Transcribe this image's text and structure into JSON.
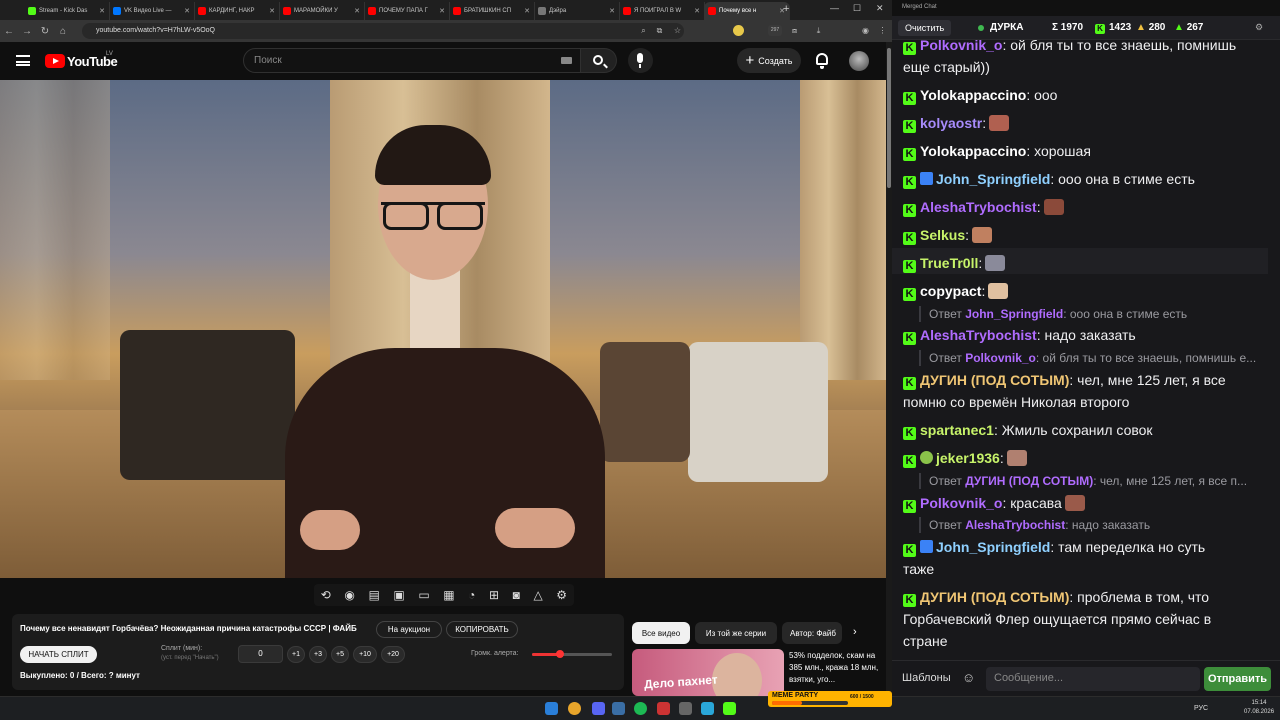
{
  "browser": {
    "tabs": [
      {
        "title": "Stream - Kick Das",
        "color": "#53fc18"
      },
      {
        "title": "VK Видео Live —",
        "color": "#0077ff"
      },
      {
        "title": "КАРДИНГ, НАКР",
        "color": "#ff0000"
      },
      {
        "title": "МАРАМОЙКИ У",
        "color": "#ff0000"
      },
      {
        "title": "ПОЧЕМУ ПАПА Г",
        "color": "#ff0000"
      },
      {
        "title": "БРАТИШКИН СП",
        "color": "#ff0000"
      },
      {
        "title": "Дэйра",
        "color": "#777777"
      },
      {
        "title": "Я ПОИГРАЛ В W",
        "color": "#ff0000"
      },
      {
        "title": "Почему все н",
        "color": "#ff0000"
      }
    ],
    "url": "youtube.com/watch?v=H7hLW-v5OoQ",
    "ext_badge": "297"
  },
  "youtube": {
    "wordmark": "YouTube",
    "region": "LV",
    "search_placeholder": "Поиск",
    "create_label": "Создать"
  },
  "panel": {
    "title": "Почему все ненавидят Горбачёва? Неожиданная причина катастрофы СССР | ФАЙБ",
    "auction_label": "На аукцион",
    "copy_label": "КОПИРОВАТЬ",
    "start_split_label": "НАЧАТЬ СПЛИТ",
    "split_min_label": "Сплит (мин):",
    "split_hint": "(уст. перед \"Начать\")",
    "split_value": "0",
    "increments": [
      "+1",
      "+3",
      "+5",
      "+10",
      "+20"
    ],
    "alert_label": "Громк. алерта:",
    "alert_volume": 0.35,
    "stats": "Выкуплено: 0 / Всего: ? минут"
  },
  "related": {
    "tabs": [
      "Все видео",
      "Из той же серии",
      "Автор: Файб"
    ],
    "thumb_text": "Дело пахнет",
    "title": "53% подделок, скам на 385 млн., кража 18 млн, взятки, уго..."
  },
  "chat": {
    "window_title": "Merged Chat",
    "clear_label": "Очистить",
    "channel": "ДУРКА",
    "stats": [
      "Σ 1970",
      "1423",
      "280",
      "267"
    ],
    "messages": [
      {
        "user": "Polkovnik_o",
        "color": "#b06cff",
        "text": ": ой бля ты то все знаешь, помнишь",
        "cont": "еще старый))"
      },
      {
        "user": "Yolokappaccino",
        "color": "#ffffff",
        "text": ": ооо"
      },
      {
        "user": "kolyaostr",
        "color": "#a78bfa",
        "text": ":"
      },
      {
        "user": "Yolokappaccino",
        "color": "#ffffff",
        "text": ": хорошая"
      },
      {
        "user": "John_Springfield",
        "color": "#8fd0ff",
        "text": ": ооо она в стиме есть"
      },
      {
        "user": "AleshaTrybochist",
        "color": "#b06cff",
        "text": ":"
      },
      {
        "user": "Selkus",
        "color": "#c7f36a",
        "text": ":"
      },
      {
        "user": "TrueTr0ll",
        "color": "#c7f36a",
        "text": ":"
      },
      {
        "user": "copypact",
        "color": "#ffffff",
        "text": ":"
      },
      {
        "reply_to": "John_Springfield",
        "reply_text": ": ооо она в стиме есть"
      },
      {
        "user": "AleshaTrybochist",
        "color": "#b06cff",
        "text": ": надо заказать"
      },
      {
        "reply_to": "Polkovnik_o",
        "reply_text": ": ой бля ты то все знаешь, помнишь е..."
      },
      {
        "user": "ДУГИН (ПОД СОТЫМ)",
        "color": "#f0c674",
        "text": ": чел, мне 125 лет, я все",
        "cont": "помню со времён Николая второго"
      },
      {
        "user": "spartanec1",
        "color": "#c7f36a",
        "text": ": Жмиль сохранил совок"
      },
      {
        "user": "jeker1936",
        "color": "#c7f36a",
        "text": ":"
      },
      {
        "reply_to": "ДУГИН (ПОД СОТЫМ)",
        "reply_text": ": чел, мне 125 лет, я все п..."
      },
      {
        "user": "Polkovnik_o",
        "color": "#b06cff",
        "text": ": красава"
      },
      {
        "reply_to": "AleshaTrybochist",
        "reply_text": ": надо заказать"
      },
      {
        "user": "John_Springfield",
        "color": "#8fd0ff",
        "text": ": там переделка но суть",
        "cont": "таже"
      },
      {
        "user": "ДУГИН (ПОД СОТЫМ)",
        "color": "#f0c674",
        "text": ": проблема в том, что",
        "cont": "Горбачевский Флер ощущается прямо сейчас в",
        "cont2": "стране"
      }
    ],
    "reply_prefix": "Ответ",
    "templates_label": "Шаблоны",
    "input_placeholder": "Сообщение...",
    "send_label": "Отправить"
  },
  "taskbar": {
    "meme_label": "MEME PARTY",
    "meme_count": "600 / 1500",
    "meme_progress": 0.4,
    "lang": "РУС",
    "time": "15:14",
    "date": "07.08.2026"
  }
}
